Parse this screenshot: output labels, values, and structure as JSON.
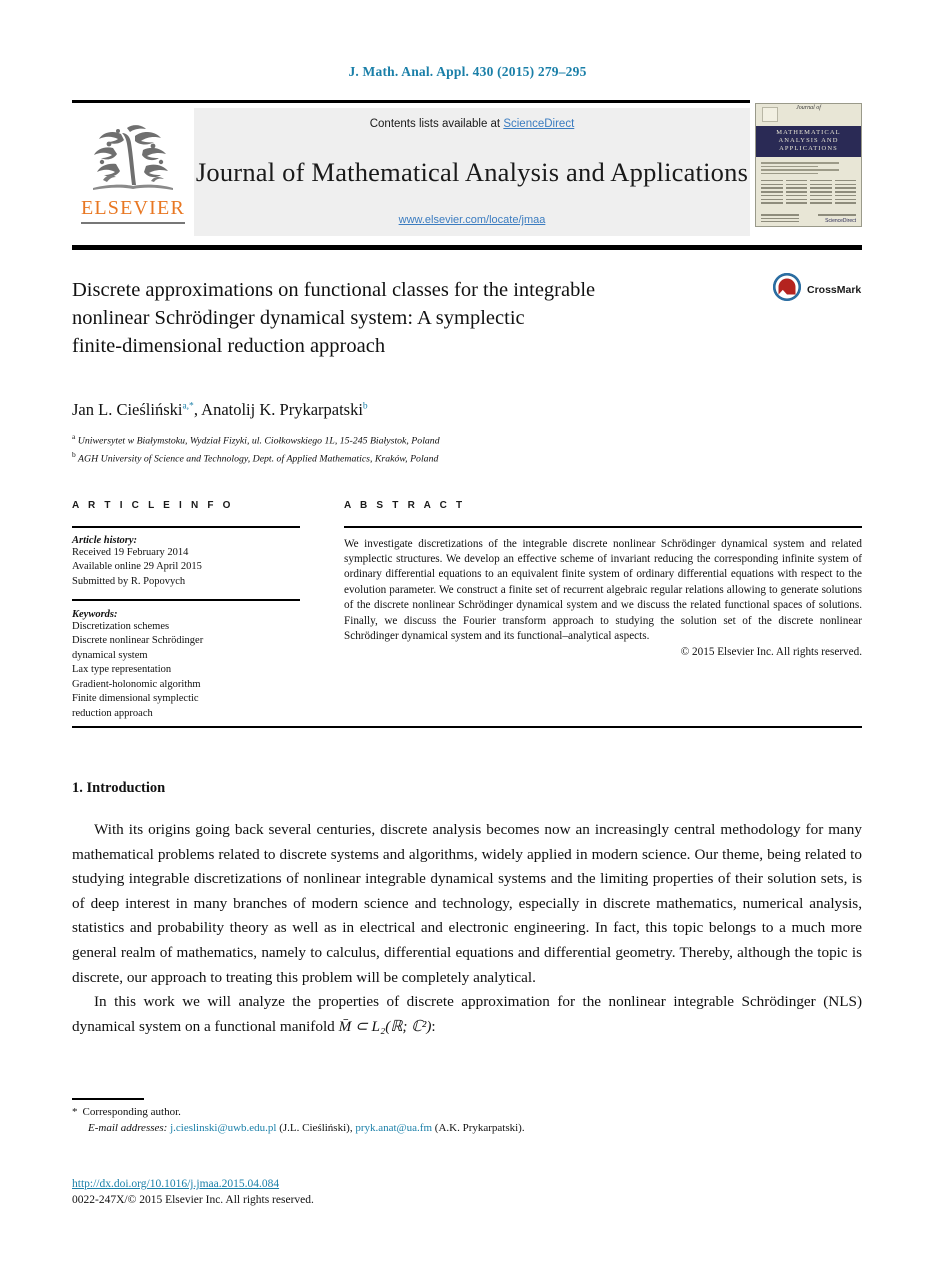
{
  "running_head": "J. Math. Anal. Appl. 430 (2015) 279–295",
  "masthead": {
    "contents_prefix": "Contents lists available at ",
    "sciencedirect": "ScienceDirect",
    "journal_title": "Journal of Mathematical Analysis and Applications",
    "journal_url": "www.elsevier.com/locate/jmaa",
    "publisher": "ELSEVIER",
    "publisher_logo_icon": "elsevier-tree-icon"
  },
  "cover": {
    "script_line": "Journal of",
    "band_lines": [
      "MATHEMATICAL",
      "ANALYSIS AND",
      "APPLICATIONS"
    ],
    "footer_mark": "ScienceDirect"
  },
  "crossmark": {
    "label": "CrossMark",
    "icon": "crossmark-icon"
  },
  "article": {
    "title_lines": [
      "Discrete approximations on functional classes for the integrable",
      "nonlinear Schrödinger dynamical system: A symplectic",
      "finite-dimensional reduction approach"
    ],
    "authors_html": "Jan L. Cieśliński<sup>a,*</sup>, Anatolij K. Prykarpatski<sup>b</sup>",
    "affiliations": [
      {
        "marker": "a",
        "text": "Uniwersytet w Białymstoku, Wydział Fizyki, ul. Ciołkowskiego 1L, 15-245 Białystok, Poland"
      },
      {
        "marker": "b",
        "text": "AGH University of Science and Technology, Dept. of Applied Mathematics, Kraków, Poland"
      }
    ]
  },
  "info": {
    "heading": "A R T I C L E   I N F O",
    "history_heading": "Article history:",
    "history": [
      "Received 19 February 2014",
      "Available online 29 April 2015",
      "Submitted by R. Popovych"
    ],
    "keywords_heading": "Keywords:",
    "keywords": [
      "Discretization schemes",
      "Discrete nonlinear Schrödinger",
      "dynamical system",
      "Lax type representation",
      "Gradient-holonomic algorithm",
      "Finite dimensional symplectic",
      "reduction approach"
    ]
  },
  "abstract": {
    "heading": "A B S T R A C T",
    "body": "We investigate discretizations of the integrable discrete nonlinear Schrödinger dynamical system and related symplectic structures. We develop an effective scheme of invariant reducing the corresponding infinite system of ordinary differential equations to an equivalent finite system of ordinary differential equations with respect to the evolution parameter. We construct a finite set of recurrent algebraic regular relations allowing to generate solutions of the discrete nonlinear Schrödinger dynamical system and we discuss the related functional spaces of solutions. Finally, we discuss the Fourier transform approach to studying the solution set of the discrete nonlinear Schrödinger dynamical system and its functional–analytical aspects.",
    "copyright": "© 2015 Elsevier Inc. All rights reserved."
  },
  "section": {
    "number_title": "1. Introduction",
    "paragraph_1": "With its origins going back several centuries, discrete analysis becomes now an increasingly central methodology for many mathematical problems related to discrete systems and algorithms, widely applied in modern science. Our theme, being related to studying integrable discretizations of nonlinear integrable dynamical systems and the limiting properties of their solution sets, is of deep interest in many branches of modern science and technology, especially in discrete mathematics, numerical analysis, statistics and probability theory as well as in electrical and electronic engineering. In fact, this topic belongs to a much more general realm of mathematics, namely to calculus, differential equations and differential geometry. Thereby, although the topic is discrete, our approach to treating this problem will be completely analytical.",
    "paragraph_2_pre": "In this work we will analyze the properties of discrete approximation for the nonlinear integrable Schrödinger (NLS) dynamical system on a functional manifold ",
    "paragraph_2_math": "M̄ ⊂ L₂(ℝ; ℂ²)",
    "paragraph_2_post": ":"
  },
  "footnotes": {
    "corresponding_marker": "*",
    "corresponding_text": "Corresponding author.",
    "email_label": "E-mail addresses:",
    "emails": [
      {
        "address": "j.cieslinski@uwb.edu.pl",
        "owner": "(J.L. Cieśliński)"
      },
      {
        "address": "pryk.anat@ua.fm",
        "owner": "(A.K. Prykarpatski)"
      }
    ]
  },
  "doi": {
    "url": "http://dx.doi.org/10.1016/j.jmaa.2015.04.084",
    "issn_line": "0022-247X/© 2015 Elsevier Inc. All rights reserved."
  },
  "colors": {
    "link_teal": "#1a7fa8",
    "link_blue": "#3b7cc0",
    "elsevier_orange": "#E87722",
    "cover_navy": "#2a2a55",
    "cover_cream": "#e8e6d6",
    "masthead_grey": "#efefef"
  }
}
